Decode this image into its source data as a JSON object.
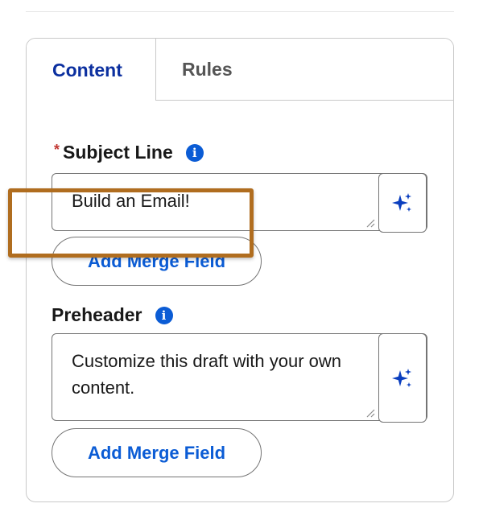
{
  "tabs": [
    {
      "label": "Content",
      "active": true
    },
    {
      "label": "Rules",
      "active": false
    }
  ],
  "subject": {
    "required_mark": "*",
    "label": "Subject Line",
    "info_icon": "info-icon",
    "value": "Build an Email!",
    "ai_icon": "sparkle-icon",
    "merge_button": "Add Merge Field"
  },
  "preheader": {
    "label": "Preheader",
    "info_icon": "info-icon",
    "value": "Customize this draft with your own content.",
    "ai_icon": "sparkle-icon",
    "merge_button": "Add Merge Field"
  },
  "colors": {
    "active_tab": "#0b2f9f",
    "link_blue": "#0b5cd5",
    "required_red": "#c23934",
    "highlight_border": "#b06d1f"
  }
}
